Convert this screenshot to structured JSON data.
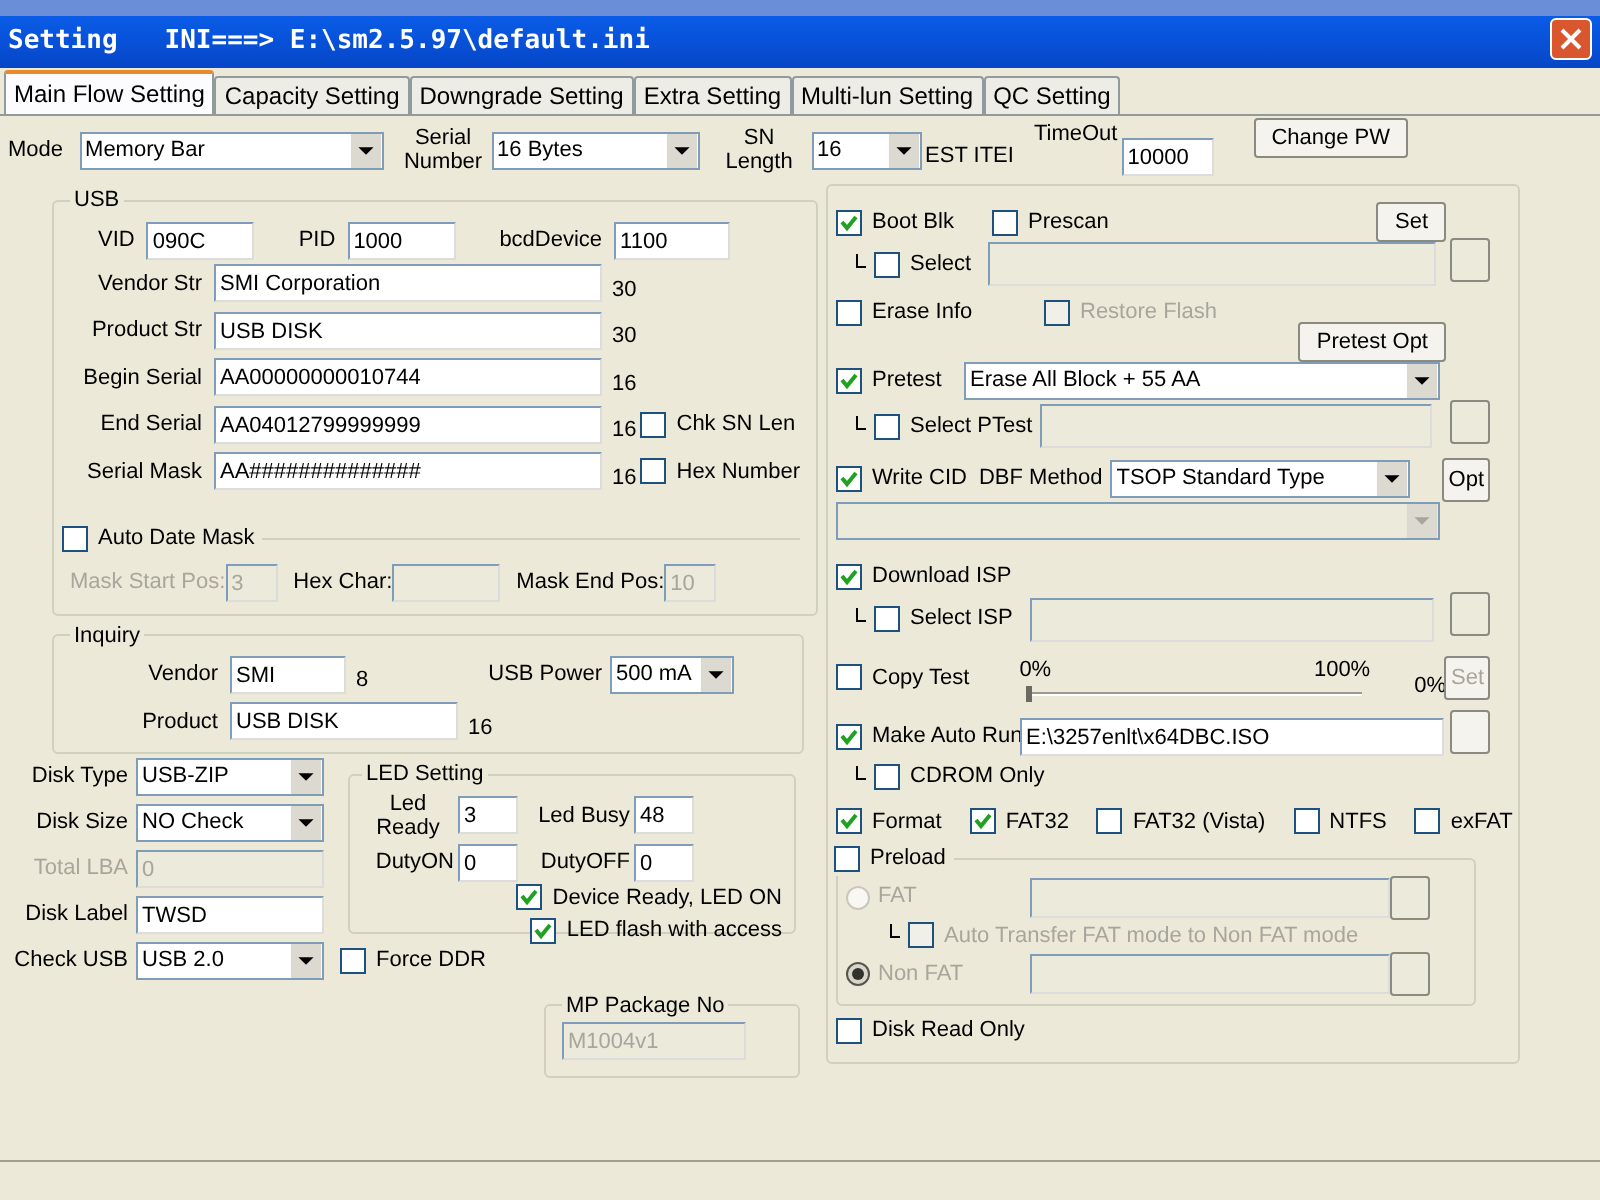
{
  "window": {
    "title": "Setting   INI===> E:\\sm2.5.97\\default.ini"
  },
  "tabs": [
    {
      "label": "Main Flow Setting",
      "selected": true
    },
    {
      "label": "Capacity Setting",
      "selected": false
    },
    {
      "label": "Downgrade Setting",
      "selected": false
    },
    {
      "label": "Extra Setting",
      "selected": false
    },
    {
      "label": "Multi-lun Setting",
      "selected": false
    },
    {
      "label": "QC Setting",
      "selected": false
    }
  ],
  "top": {
    "mode": {
      "label": "Mode",
      "value": "Memory Bar"
    },
    "serial_number": {
      "label": "Serial Number",
      "value": "16 Bytes"
    },
    "sn_length": {
      "label": "SN Length",
      "value": "16"
    },
    "test_item_label": "EST ITEI",
    "timeout": {
      "label": "TimeOut",
      "value": "10000"
    },
    "change_pw": "Change PW"
  },
  "usb": {
    "title": "USB",
    "ids": [
      {
        "label": "VID",
        "value": "090C"
      },
      {
        "label": "PID",
        "value": "1000"
      },
      {
        "label": "bcdDevice",
        "value": "1100"
      }
    ],
    "strings": [
      {
        "label": "Vendor Str",
        "value": "SMI Corporation",
        "count": "30"
      },
      {
        "label": "Product Str",
        "value": "USB DISK",
        "count": "30"
      },
      {
        "label": "Begin Serial",
        "value": "AA00000000010744",
        "count": "16"
      },
      {
        "label": "End Serial",
        "value": "AA04012799999999",
        "count": "16",
        "option": {
          "label": "Chk SN Len",
          "checked": false
        }
      },
      {
        "label": "Serial Mask",
        "value": "AA##############",
        "count": "16",
        "option": {
          "label": "Hex Number",
          "checked": false
        }
      }
    ],
    "auto_date_mask": {
      "label": "Auto Date Mask",
      "checked": false
    },
    "mask_fields": [
      {
        "label": "Mask Start Pos:",
        "value": "3",
        "disabled": true
      },
      {
        "label": "Hex Char:",
        "disabled": false
      },
      {
        "label": "Mask End Pos:",
        "value": "10",
        "disabled": false
      }
    ]
  },
  "inquiry": {
    "title": "Inquiry",
    "vendor": {
      "label": "Vendor",
      "value": "SMI",
      "count": "8"
    },
    "product": {
      "label": "Product",
      "value": "USB DISK",
      "count": "16"
    },
    "usb_power": {
      "label": "USB Power",
      "value": "500 mA"
    }
  },
  "disk": [
    {
      "kind": "combo",
      "label": "Disk Type",
      "value": "USB-ZIP"
    },
    {
      "kind": "combo",
      "label": "Disk Size",
      "value": "NO Check"
    },
    {
      "kind": "field",
      "label": "Total LBA",
      "value": "0",
      "disabled": true
    },
    {
      "kind": "field",
      "label": "Disk Label",
      "value": "TWSD",
      "disabled": false
    },
    {
      "kind": "combo",
      "label": "Check USB",
      "value": "USB 2.0"
    }
  ],
  "force_ddr": {
    "label": "Force DDR",
    "checked": false
  },
  "led": {
    "title": "LED Setting",
    "fields": [
      {
        "label": "Led Ready",
        "value": "3"
      },
      {
        "label": "Led Busy",
        "value": "48"
      },
      {
        "label": "DutyON",
        "value": "0"
      },
      {
        "label": "DutyOFF",
        "value": "0"
      }
    ],
    "options": [
      {
        "label": "Device Ready, LED ON",
        "checked": true
      },
      {
        "label": "LED flash with access",
        "checked": true
      }
    ]
  },
  "mp_package": {
    "title": "MP Package No",
    "value": "M1004v1"
  },
  "flow": {
    "boot_blk": {
      "label": "Boot Blk",
      "checked": true
    },
    "prescan": {
      "label": "Prescan",
      "checked": false
    },
    "set": "Set",
    "boot_select": {
      "label": "Select",
      "checked": false
    },
    "erase_info": {
      "label": "Erase Info",
      "checked": false
    },
    "restore_flash": {
      "label": "Restore Flash",
      "checked": false,
      "disabled": true
    },
    "pretest_opt": "Pretest Opt",
    "pretest": {
      "label": "Pretest",
      "checked": true,
      "value": "Erase All Block + 55 AA"
    },
    "select_ptest": {
      "label": "Select PTest",
      "checked": false
    },
    "write_cid": {
      "label": "Write CID",
      "checked": true
    },
    "dbf_method": {
      "label": "DBF Method",
      "value": "TSOP Standard Type"
    },
    "opt": "Opt",
    "download_isp": {
      "label": "Download ISP",
      "checked": true
    },
    "select_isp": {
      "label": "Select ISP",
      "checked": false
    },
    "copy_test": {
      "label": "Copy Test",
      "checked": false,
      "min": "0%",
      "max": "100%",
      "level": 0,
      "reading": "0%",
      "set": "Set"
    },
    "auto_run": {
      "label": "Make Auto Run",
      "checked": true,
      "value": "E:\\3257enlt\\x64DBC.ISO"
    },
    "cdrom_only": {
      "label": "CDROM Only",
      "checked": false
    },
    "format": {
      "label": "Format",
      "checked": true,
      "types": [
        {
          "label": "FAT32",
          "checked": true
        },
        {
          "label": "FAT32 (Vista)",
          "checked": false
        },
        {
          "label": "NTFS",
          "checked": false
        },
        {
          "label": "exFAT",
          "checked": false
        }
      ]
    },
    "preload": {
      "label": "Preload",
      "checked": false,
      "modes": [
        {
          "label": "FAT",
          "selected": false
        },
        {
          "label": "Non FAT",
          "selected": true
        }
      ],
      "auto_transfer": {
        "label": "Auto Transfer FAT mode to Non FAT mode",
        "checked": false
      }
    },
    "disk_read_only": {
      "label": "Disk Read Only",
      "checked": false
    }
  }
}
